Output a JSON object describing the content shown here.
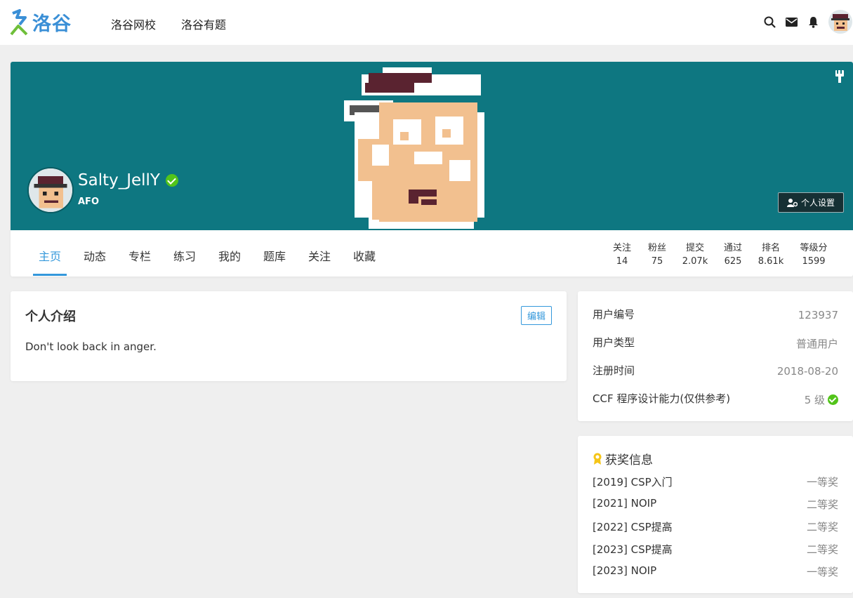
{
  "brand": {
    "name": "洛谷"
  },
  "nav": [
    {
      "label": "洛谷网校"
    },
    {
      "label": "洛谷有题"
    }
  ],
  "top_icons": [
    "search-icon",
    "mail-icon",
    "bell-icon",
    "user-avatar"
  ],
  "profile": {
    "username": "Salty_JellY",
    "tag": "AFO",
    "settings_label": "个人设置",
    "banner_color": "#0e7781"
  },
  "tabs": [
    {
      "label": "主页",
      "active": true
    },
    {
      "label": "动态"
    },
    {
      "label": "专栏"
    },
    {
      "label": "练习"
    },
    {
      "label": "我的"
    },
    {
      "label": "题库"
    },
    {
      "label": "关注"
    },
    {
      "label": "收藏"
    }
  ],
  "stats": [
    {
      "label": "关注",
      "value": "14"
    },
    {
      "label": "粉丝",
      "value": "75"
    },
    {
      "label": "提交",
      "value": "2.07k"
    },
    {
      "label": "通过",
      "value": "625"
    },
    {
      "label": "排名",
      "value": "8.61k"
    },
    {
      "label": "等级分",
      "value": "1599"
    }
  ],
  "intro": {
    "title": "个人介绍",
    "edit_label": "编辑",
    "text": "Don't look back in anger."
  },
  "info": [
    {
      "key": "用户编号",
      "value": "123937"
    },
    {
      "key": "用户类型",
      "value": "普通用户"
    },
    {
      "key": "注册时间",
      "value": "2018-08-20"
    },
    {
      "key": "CCF 程序设计能力(仅供参考)",
      "value": "5 级"
    }
  ],
  "awards": {
    "title": "获奖信息",
    "items": [
      {
        "name": "[2019] CSP入门",
        "level": "一等奖"
      },
      {
        "name": "[2021] NOIP",
        "level": "二等奖"
      },
      {
        "name": "[2022] CSP提高",
        "level": "二等奖"
      },
      {
        "name": "[2023] CSP提高",
        "level": "二等奖"
      },
      {
        "name": "[2023] NOIP",
        "level": "一等奖"
      }
    ]
  },
  "colors": {
    "accent": "#3498db",
    "success": "#52c41a",
    "award": "#f5c518"
  }
}
